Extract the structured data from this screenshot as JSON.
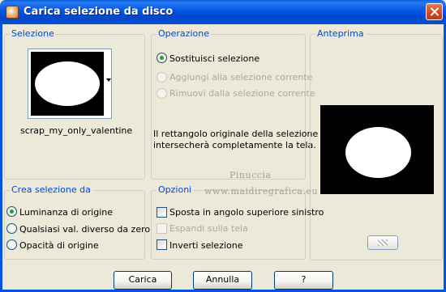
{
  "window": {
    "title": "Carica selezione da disco",
    "close_icon": "close-icon",
    "app_icon": "psp-icon"
  },
  "selezione": {
    "legend": "Selezione",
    "file_name": "scrap_my_only_valentine"
  },
  "operazione": {
    "legend": "Operazione",
    "options": [
      {
        "label": "Sostituisci selezione",
        "checked": true,
        "enabled": true
      },
      {
        "label": "Aggiungi alla selezione corrente",
        "checked": false,
        "enabled": false
      },
      {
        "label": "Rimuovi dalla selezione corrente",
        "checked": false,
        "enabled": false
      }
    ],
    "info_line1": "Il rettangolo originale della selezione",
    "info_line2": "intersecherà completamente la tela."
  },
  "anteprima": {
    "legend": "Anteprima"
  },
  "crea": {
    "legend": "Crea selezione da",
    "options": [
      {
        "label": "Luminanza di origine",
        "checked": true
      },
      {
        "label": "Qualsiasi val. diverso da zero",
        "checked": false
      },
      {
        "label": "Opacità di origine",
        "checked": false
      }
    ]
  },
  "opzioni": {
    "legend": "Opzioni",
    "items": [
      {
        "label": "Sposta in angolo superiore sinistro",
        "checked": false,
        "enabled": true
      },
      {
        "label": "Espandi sulla tela",
        "checked": false,
        "enabled": false
      },
      {
        "label": "Inverti selezione",
        "checked": false,
        "enabled": true
      }
    ]
  },
  "watermark": {
    "line1": "Pinuccia",
    "line2": "www.maidiregrafica.eu"
  },
  "buttons": {
    "ok": "Carica",
    "cancel": "Annulla",
    "help": "?"
  }
}
